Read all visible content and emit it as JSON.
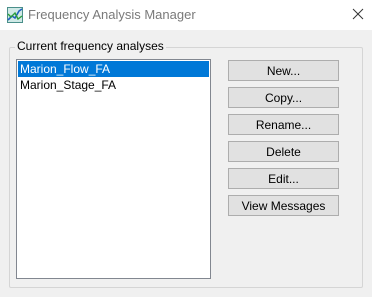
{
  "window": {
    "title": "Frequency Analysis Manager",
    "icon": "frequency-chart-icon",
    "close_icon": "close-icon"
  },
  "group": {
    "label": "Current frequency analyses"
  },
  "analyses": [
    {
      "label": "Marion_Flow_FA",
      "selected": true
    },
    {
      "label": "Marion_Stage_FA",
      "selected": false
    }
  ],
  "buttons": {
    "new": "New...",
    "copy": "Copy...",
    "rename": "Rename...",
    "delete": "Delete",
    "edit": "Edit...",
    "view_messages": "View Messages"
  },
  "colors": {
    "selection": "#0078d7",
    "button_face": "#e1e1e1",
    "button_border": "#adadad"
  }
}
